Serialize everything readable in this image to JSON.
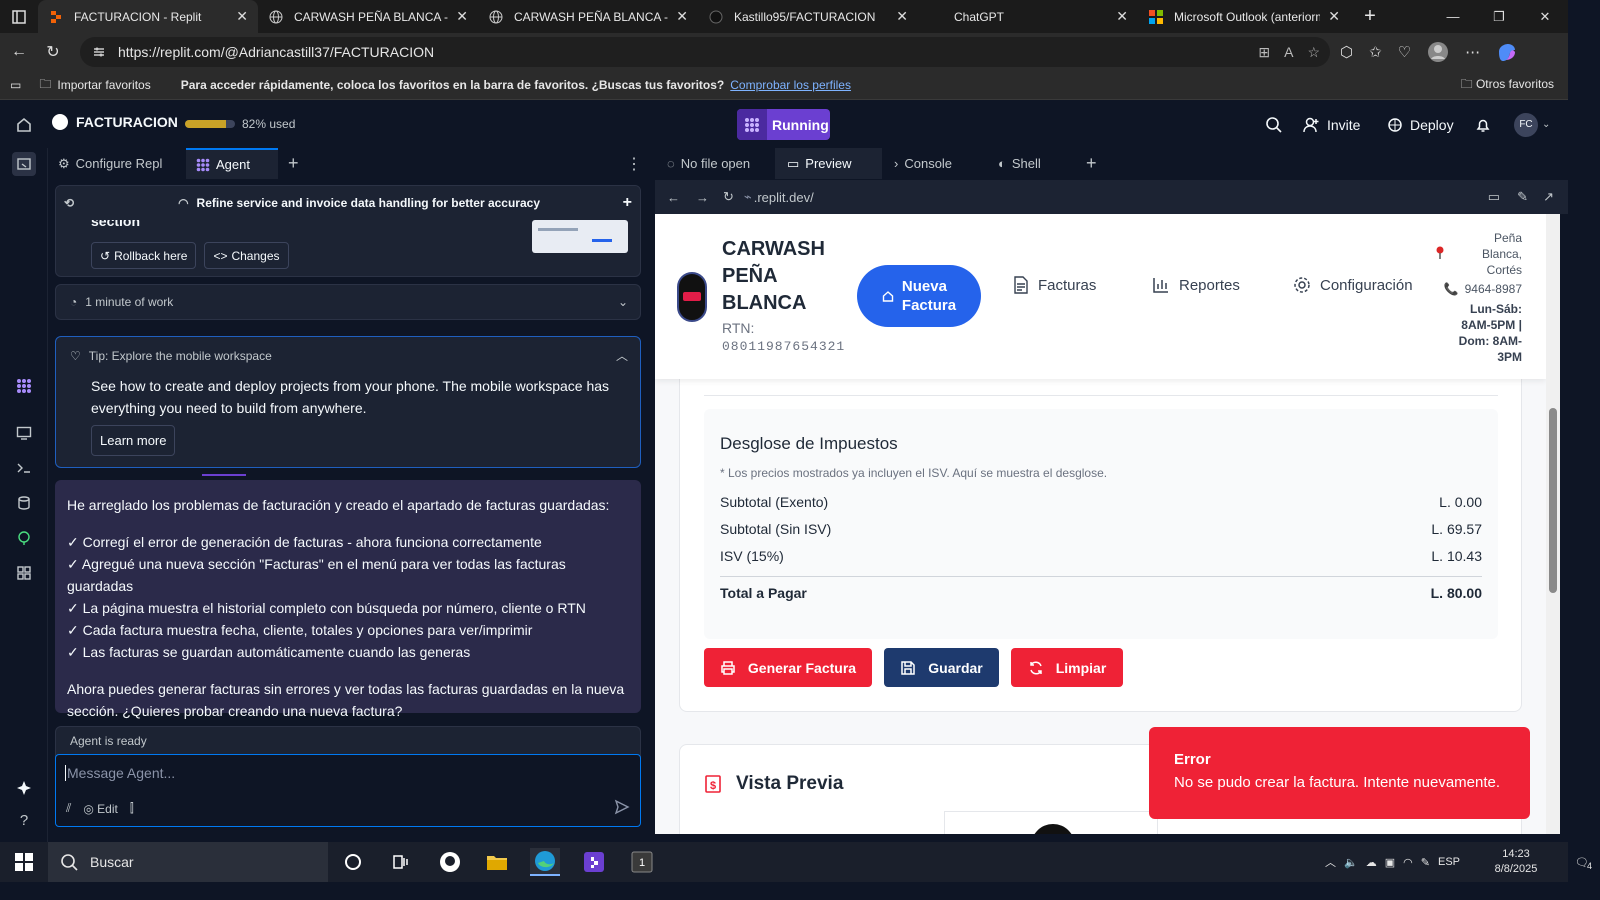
{
  "browser": {
    "tabs": [
      {
        "title": "FACTURACION - Replit",
        "active": true
      },
      {
        "title": "CARWASH PEÑA BLANCA - Sis",
        "active": false
      },
      {
        "title": "CARWASH PEÑA BLANCA - Sis",
        "active": false
      },
      {
        "title": "Kastillo95/FACTURACION",
        "active": false
      },
      {
        "title": "ChatGPT",
        "active": false
      },
      {
        "title": "Microsoft Outlook (anteriorme",
        "active": false
      }
    ],
    "url": "https://replit.com/@Adriancastill37/FACTURACION",
    "favbar": {
      "import_label": "Importar favoritos",
      "hint": "Para acceder rápidamente, coloca los favoritos en la barra de favoritos. ¿Buscas tus favoritos?",
      "link": "Comprobar los perfiles",
      "other": "Otros favoritos"
    }
  },
  "replit": {
    "project_name": "FACTURACION",
    "usage_fraction": 0.82,
    "usage_label": "82% used",
    "run_status": "Running",
    "invite_label": "Invite",
    "deploy_label": "Deploy",
    "avatar_initials": "FC",
    "left_tabs": {
      "configure": "Configure Repl",
      "agent": "Agent"
    },
    "right_tabs": {
      "nofile": "No file open",
      "preview": "Preview",
      "console": "Console",
      "shell": "Shell"
    },
    "preview_url": ".replit.dev/"
  },
  "agent": {
    "checkpoint_title": "Refine service and invoice data handling for better accuracy",
    "section_partial": "section",
    "rollback_label": "Rollback here",
    "changes_label": "Changes",
    "work_time": "1 minute of work",
    "tip_title": "Tip: Explore the mobile workspace",
    "tip_body": "See how to create and deploy projects from your phone. The mobile workspace has everything you need to build from anywhere.",
    "learn_more": "Learn more",
    "message_intro": "He arreglado los problemas de facturación y creado el apartado de facturas guardadas:",
    "message_items": [
      "✓ Corregí el error de generación de facturas - ahora funciona correctamente",
      "✓ Agregué una nueva sección \"Facturas\" en el menú para ver todas las facturas guardadas",
      "✓ La página muestra el historial completo con búsqueda por número, cliente o RTN",
      "✓ Cada factura muestra fecha, cliente, totales y opciones para ver/imprimir",
      "✓ Las facturas se guardan automáticamente cuando las generas"
    ],
    "message_outro": "Ahora puedes generar facturas sin errores y ver todas las facturas guardadas en la nueva sección. ¿Quieres probar creando una nueva factura?",
    "status": "Agent is ready",
    "input_placeholder": "Message Agent...",
    "edit_label": "Edit"
  },
  "site": {
    "brand_line1": "CARWASH",
    "brand_line2": "PEÑA",
    "brand_line3": "BLANCA",
    "rtn_label": "RTN:",
    "rtn_value": "08011987654321",
    "new_invoice_line1": "Nueva",
    "new_invoice_line2": "Factura",
    "nav": {
      "facturas": "Facturas",
      "reportes": "Reportes",
      "config": "Configuración"
    },
    "address_line1": "Peña",
    "address_line2": "Blanca,",
    "address_line3": "Cortés",
    "phone": "9464-8987",
    "hours_line1": "Lun-Sáb:",
    "hours_line2": "8AM-5PM |",
    "hours_line3": "Dom: 8AM-",
    "hours_line4": "3PM",
    "tax_title": "Desglose de Impuestos",
    "tax_note": "* Los precios mostrados ya incluyen el ISV. Aquí se muestra el desglose.",
    "tax_rows": [
      {
        "label": "Subtotal (Exento)",
        "value": "L. 0.00"
      },
      {
        "label": "Subtotal (Sin ISV)",
        "value": "L. 69.57"
      },
      {
        "label": "ISV (15%)",
        "value": "L. 10.43"
      }
    ],
    "total_label": "Total a Pagar",
    "total_value": "L. 80.00",
    "btn_generate": "Generar Factura",
    "btn_save": "Guardar",
    "btn_clear": "Limpiar",
    "preview_title": "Vista Previa",
    "toast_title": "Error",
    "toast_body": "No se pudo crear la factura. Intente nuevamente."
  },
  "taskbar": {
    "search": "Buscar",
    "lang": "ESP",
    "time": "14:23",
    "date": "8/8/2025",
    "notif_count": "4"
  },
  "colors": {
    "replit_bg": "#0e1525",
    "accent_blue": "#2563eb",
    "danger_red": "#ef2236",
    "navy": "#1e3a6e",
    "running_purple": "#6b3fd1"
  }
}
